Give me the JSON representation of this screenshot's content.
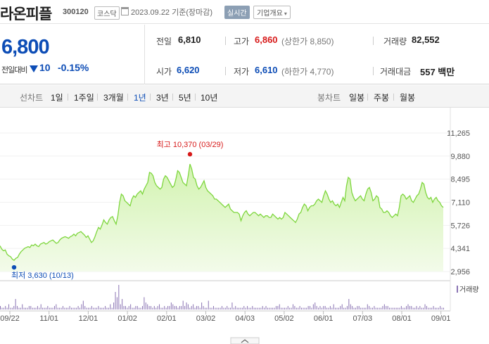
{
  "header": {
    "name": "라온피플",
    "code": "300120",
    "market": "코스닥",
    "date": "2023.09.22",
    "basis": "기준(장마감)",
    "realtime_label": "실시간",
    "company_label": "기업개요"
  },
  "quote": {
    "price": "6,800",
    "diff_label": "전일대비",
    "diff_value": "10",
    "diff_rate": "-0.15%",
    "prev_label": "전일",
    "prev": "6,810",
    "high_label": "고가",
    "high": "6,860",
    "upper_limit_label": "(상한가 8,850)",
    "volume_label": "거래량",
    "volume": "82,552",
    "open_label": "시가",
    "open": "6,620",
    "low_label": "저가",
    "low": "6,610",
    "lower_limit_label": "(하한가 4,770)",
    "amount_label": "거래대금",
    "amount": "557 백만"
  },
  "periods": {
    "label": "선차트",
    "items": [
      "1일",
      "1주일",
      "3개월",
      "1년",
      "3년",
      "5년",
      "10년"
    ],
    "active": "1년",
    "candle_label": "봉차트",
    "candle_items": [
      "일봉",
      "주봉",
      "월봉"
    ]
  },
  "colors": {
    "line": "#7ed63e",
    "fill_top": "#d2f3b0",
    "fill_bottom": "#f3fbea",
    "price_down": "#0d4db6",
    "price_up": "#d71a1a",
    "volume_bar": "#8a73b3"
  },
  "chart_data": {
    "type": "area",
    "y_ticks": [
      "11,265",
      "9,880",
      "8,495",
      "7,110",
      "5,726",
      "4,341",
      "2,956"
    ],
    "ylim": [
      2956,
      11265
    ],
    "x_ticks": [
      "09/22",
      "11/01",
      "12/01",
      "01/02",
      "02/01",
      "03/02",
      "04/03",
      "05/02",
      "06/01",
      "07/03",
      "08/01",
      "09/01"
    ],
    "high_annotation": "최고 10,370 (03/29)",
    "low_annotation": "최저 3,630 (10/13)",
    "volume_label": "거래량",
    "series": [
      {
        "values": [
          4500,
          4300,
          4200,
          4250,
          4000,
          3900,
          3850,
          3700,
          3630,
          3750,
          3800,
          4000,
          4150,
          4250,
          4350,
          4400,
          4450,
          4400,
          4550,
          4500,
          4600,
          4500,
          4450,
          4600,
          4650,
          4700,
          4600,
          4650,
          4750,
          4800,
          4850,
          4750,
          4650,
          4700,
          4850,
          4950,
          5000,
          5050,
          5000,
          4950,
          5050,
          5100,
          5200,
          5100,
          5250,
          5300,
          5350,
          5250,
          5150,
          5000,
          5100,
          4900,
          4700,
          4800,
          5050,
          5350,
          5600,
          5500,
          5750,
          6050,
          5900,
          5800,
          6050,
          6200,
          6250,
          6000,
          5800,
          6300,
          7100,
          7600,
          7500,
          7200,
          7100,
          7000,
          6900,
          7300,
          7500,
          7400,
          7600,
          7700,
          7800,
          7600,
          7900,
          8100,
          8300,
          8900,
          8850,
          8700,
          8300,
          8100,
          8000,
          7900,
          8000,
          8500,
          8700,
          8600,
          8400,
          8200,
          8000,
          8100,
          8500,
          9000,
          8900,
          8600,
          8300,
          8200,
          8100,
          8700,
          9400,
          9100,
          8600,
          8500,
          8100,
          7900,
          8000,
          8200,
          8400,
          8000,
          7800,
          7700,
          7600,
          7500,
          7300,
          7300,
          7200,
          7100,
          7000,
          6900,
          6800,
          6900,
          7000,
          6700,
          6600,
          6500,
          6500,
          6500,
          6400,
          6000,
          6300,
          6500,
          6600,
          6400,
          6300,
          6400,
          6500,
          6500,
          6400,
          6300,
          6400,
          6300,
          6200,
          6300,
          6300,
          6200,
          6200,
          6400,
          6300,
          6200,
          6100,
          6200,
          6100,
          6200,
          6500,
          6400,
          6300,
          6200,
          6100,
          6000,
          5900,
          6100,
          6400,
          6500,
          6800,
          7000,
          6900,
          6600,
          6800,
          6900,
          6900,
          7000,
          7200,
          7300,
          7200,
          7100,
          7500,
          7800,
          7600,
          7300,
          7100,
          7200,
          7000,
          6900,
          7000,
          6800,
          7100,
          7400,
          7200,
          8100,
          8600,
          8500,
          7700,
          7400,
          7200,
          7300,
          7400,
          7500,
          7300,
          7200,
          7600,
          7900,
          8000,
          7700,
          7200,
          7300,
          7500,
          7400,
          6800,
          6700,
          6500,
          6500,
          6600,
          6500,
          6300,
          6200,
          6300,
          6400,
          6300,
          6800,
          7500,
          7600,
          7500,
          7300,
          7400,
          7500,
          7200,
          7100,
          7300,
          7500,
          7600,
          7900,
          8300,
          8200,
          7700,
          7400,
          7300,
          7400,
          7100,
          7300,
          7400,
          7200,
          7100,
          6900,
          6800
        ]
      }
    ],
    "volume": [
      2,
      1,
      1,
      2,
      1,
      3,
      1,
      1,
      2,
      6,
      2,
      1,
      1,
      3,
      1,
      1,
      1,
      2,
      2,
      1,
      1,
      1,
      2,
      1,
      3,
      1,
      1,
      1,
      2,
      1,
      1,
      1,
      2,
      3,
      1,
      1,
      1,
      2,
      1,
      1,
      1,
      2,
      1,
      1,
      1,
      1,
      2,
      1,
      3,
      5,
      2,
      1,
      1,
      1,
      2,
      1,
      1,
      1,
      2,
      1,
      1,
      1,
      2,
      1,
      1,
      3,
      1,
      4,
      10,
      7,
      14,
      3,
      6,
      2,
      2,
      1,
      2,
      3,
      1,
      1,
      2,
      2,
      1,
      1,
      2,
      7,
      4,
      3,
      2,
      2,
      1,
      2,
      1,
      2,
      3,
      1,
      1,
      2,
      1,
      2,
      2,
      4,
      3,
      2,
      2,
      1,
      2,
      2,
      5,
      2,
      4,
      3,
      1,
      2,
      3,
      1,
      2,
      2,
      1,
      4,
      2,
      1,
      1,
      5,
      1,
      1,
      2,
      1,
      1,
      1,
      1,
      2,
      1,
      1,
      2,
      1,
      1,
      4,
      1,
      2,
      1,
      1,
      1,
      1,
      2,
      1,
      2,
      1,
      1,
      2,
      1,
      1,
      1,
      1,
      1,
      2,
      1,
      2,
      1,
      1,
      1,
      1,
      1,
      2,
      2,
      3,
      1,
      1,
      1,
      1,
      2,
      1,
      1,
      3,
      2,
      1,
      1,
      2,
      1,
      1,
      1,
      1,
      2,
      2,
      1,
      3,
      4,
      2,
      1,
      2,
      1,
      2,
      2,
      1,
      1,
      2,
      1,
      3,
      1,
      1,
      1,
      2,
      3,
      1,
      1,
      2,
      6,
      3,
      2,
      1,
      1,
      2,
      2,
      1,
      1,
      1,
      1,
      3,
      2,
      1,
      1,
      2,
      1,
      1,
      1,
      1,
      2,
      3,
      2,
      2,
      1,
      1,
      1,
      1,
      1,
      1,
      1,
      2,
      1,
      1,
      2,
      3,
      2,
      2,
      1,
      1,
      2,
      1,
      2,
      1,
      1,
      3,
      2,
      1,
      1,
      1,
      2,
      1,
      1,
      1,
      2,
      1,
      1
    ]
  }
}
